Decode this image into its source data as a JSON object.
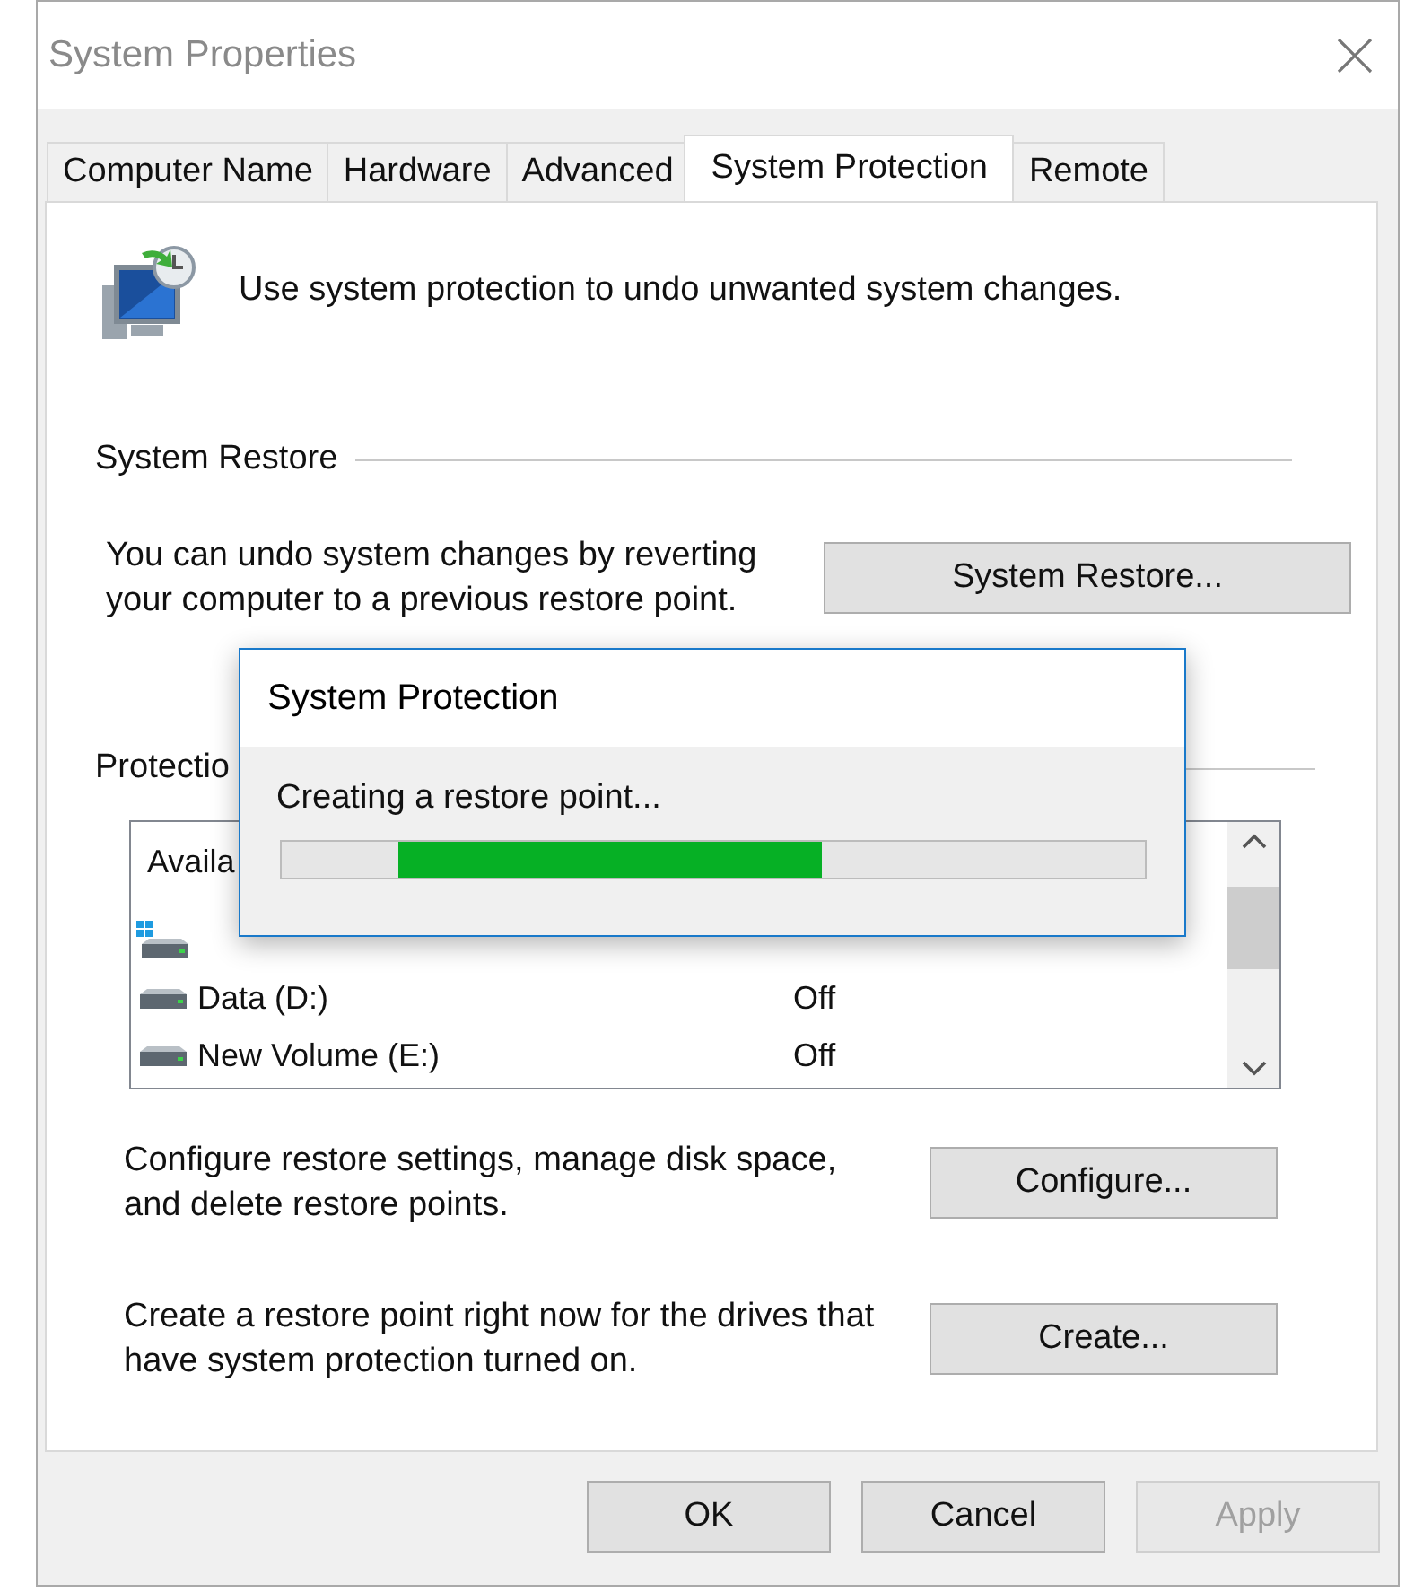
{
  "window": {
    "title": "System Properties"
  },
  "tabs": [
    {
      "label": "Computer Name",
      "selected": false
    },
    {
      "label": "Hardware",
      "selected": false
    },
    {
      "label": "Advanced",
      "selected": false
    },
    {
      "label": "System Protection",
      "selected": true
    },
    {
      "label": "Remote",
      "selected": false
    }
  ],
  "intro": "Use system protection to undo unwanted system changes.",
  "system_restore": {
    "heading": "System Restore",
    "description": "You can undo system changes by reverting your computer to a previous restore point.",
    "button": "System Restore..."
  },
  "protection": {
    "heading": "Protectio",
    "column_1": "Availa",
    "drives": [
      {
        "kind": "system"
      },
      {
        "name": "Data (D:)",
        "status": "Off",
        "kind": "data"
      },
      {
        "name": "New Volume (E:)",
        "status": "Off",
        "kind": "data"
      }
    ]
  },
  "configure": {
    "description": "Configure restore settings, manage disk space, and delete restore points.",
    "button": "Configure..."
  },
  "create": {
    "description": "Create a restore point right now for the drives that have system protection turned on.",
    "button": "Create..."
  },
  "buttons": [
    {
      "label": "OK",
      "disabled": false
    },
    {
      "label": "Cancel",
      "disabled": false
    },
    {
      "label": "Apply",
      "disabled": true
    }
  ],
  "progress_dialog": {
    "title": "System Protection",
    "message": "Creating a restore point..."
  }
}
